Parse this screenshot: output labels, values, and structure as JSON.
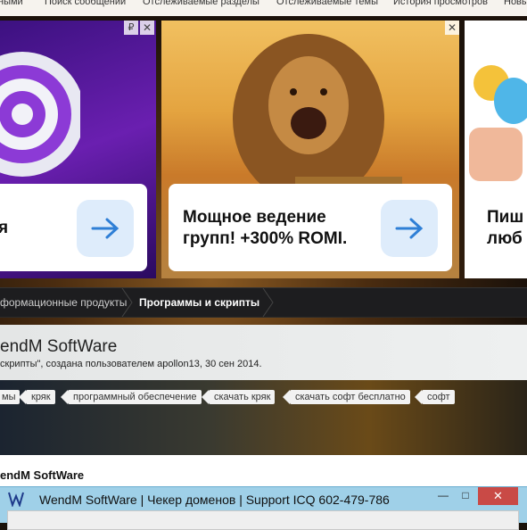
{
  "topnav": {
    "items": [
      "ными",
      "Поиск сообщений",
      "Отслеживаемые разделы",
      "Отслеживаемые темы",
      "История просмотров",
      "Новы"
    ]
  },
  "ads": {
    "ad1": {
      "text": "я",
      "badge": "₽",
      "close": "✕"
    },
    "ad2": {
      "line1": "Мощное ведение",
      "line2": "групп! +300% ROMI.",
      "close": "✕"
    },
    "ad3": {
      "line1": "Пиш",
      "line2": "люб"
    }
  },
  "breadcrumb": {
    "items": [
      "формационные продукты",
      "Программы и скрипты"
    ]
  },
  "thread": {
    "title": "endM SoftWare",
    "meta": "скрипты\", создана пользователем apollon13, 30 сен 2014."
  },
  "tags": [
    "мы",
    "кряк",
    "программный обеспечение",
    "скачать кряк",
    "скачать софт бесплатно",
    "софт"
  ],
  "post": {
    "label": "endM SoftWare"
  },
  "window": {
    "title": "WendM SoftWare | Чекер доменов |  Support ICQ 602-479-786",
    "minimize": "—",
    "maximize": "□",
    "close": "✕"
  },
  "colors": {
    "accent_blue": "#2f7fd6",
    "ad_purple": "#5a1aa0",
    "close_red": "#c94a46"
  }
}
